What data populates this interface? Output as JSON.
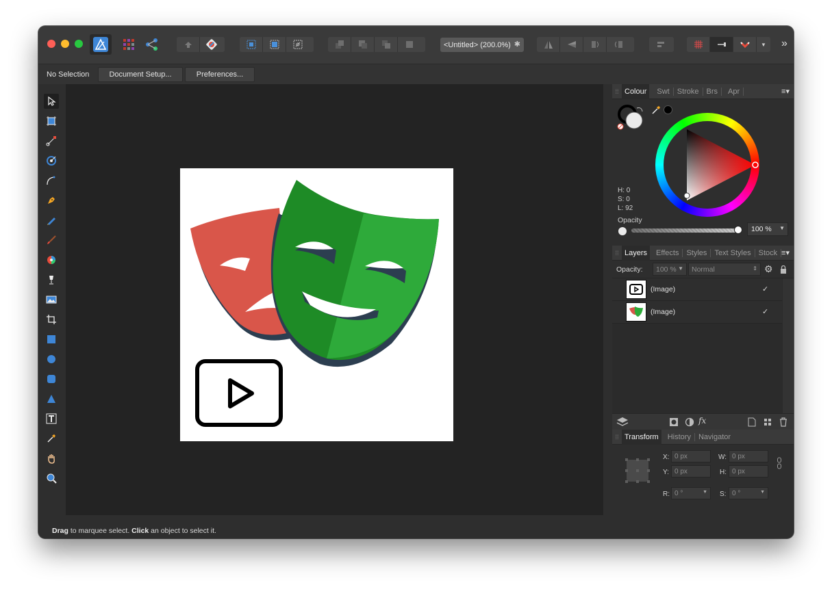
{
  "toolbar": {
    "document_tab": "<Untitled> (200.0%)",
    "overflow": "»"
  },
  "context": {
    "selection_label": "No Selection",
    "document_setup": "Document Setup...",
    "preferences": "Preferences..."
  },
  "status": {
    "drag": "Drag",
    "drag_text": " to marquee select. ",
    "click": "Click",
    "click_text": " an object to select it."
  },
  "colour_panel": {
    "tabs": [
      "Colour",
      "Swt",
      "Stroke",
      "Brs",
      "Apr"
    ],
    "h": "H: 0",
    "s": "S: 0",
    "l": "L: 92",
    "opacity_label": "Opacity",
    "opacity_value": "100 %",
    "opacity_fraction": 1.0,
    "fill_color": "#ebebeb",
    "stroke_color": "#000000",
    "hue_marker_color": "#ff0000"
  },
  "layers_panel": {
    "tabs": [
      "Layers",
      "Effects",
      "Styles",
      "Text Styles",
      "Stock"
    ],
    "opacity_label": "Opacity:",
    "opacity_value": "100 %",
    "blend_mode": "Normal",
    "layers": [
      {
        "name": "(Image)",
        "visible": true,
        "thumb": "play-button-icon"
      },
      {
        "name": "(Image)",
        "visible": true,
        "thumb": "theatre-masks-icon"
      }
    ],
    "check_glyph": "✓"
  },
  "transform_panel": {
    "tabs": [
      "Transform",
      "History",
      "Navigator"
    ],
    "x_label": "X:",
    "x": "0 px",
    "y_label": "Y:",
    "y": "0 px",
    "w_label": "W:",
    "w": "0 px",
    "h_label": "H:",
    "h": "0 px",
    "r_label": "R:",
    "r": "0 °",
    "s_label": "S:",
    "s": "0 °"
  },
  "colors": {
    "mask_red": "#d9564a",
    "mask_green_dark": "#1e8b26",
    "mask_green_light": "#2eaa3a",
    "mask_shadow": "#2c3e50",
    "accent_blue": "#3e86d6"
  }
}
